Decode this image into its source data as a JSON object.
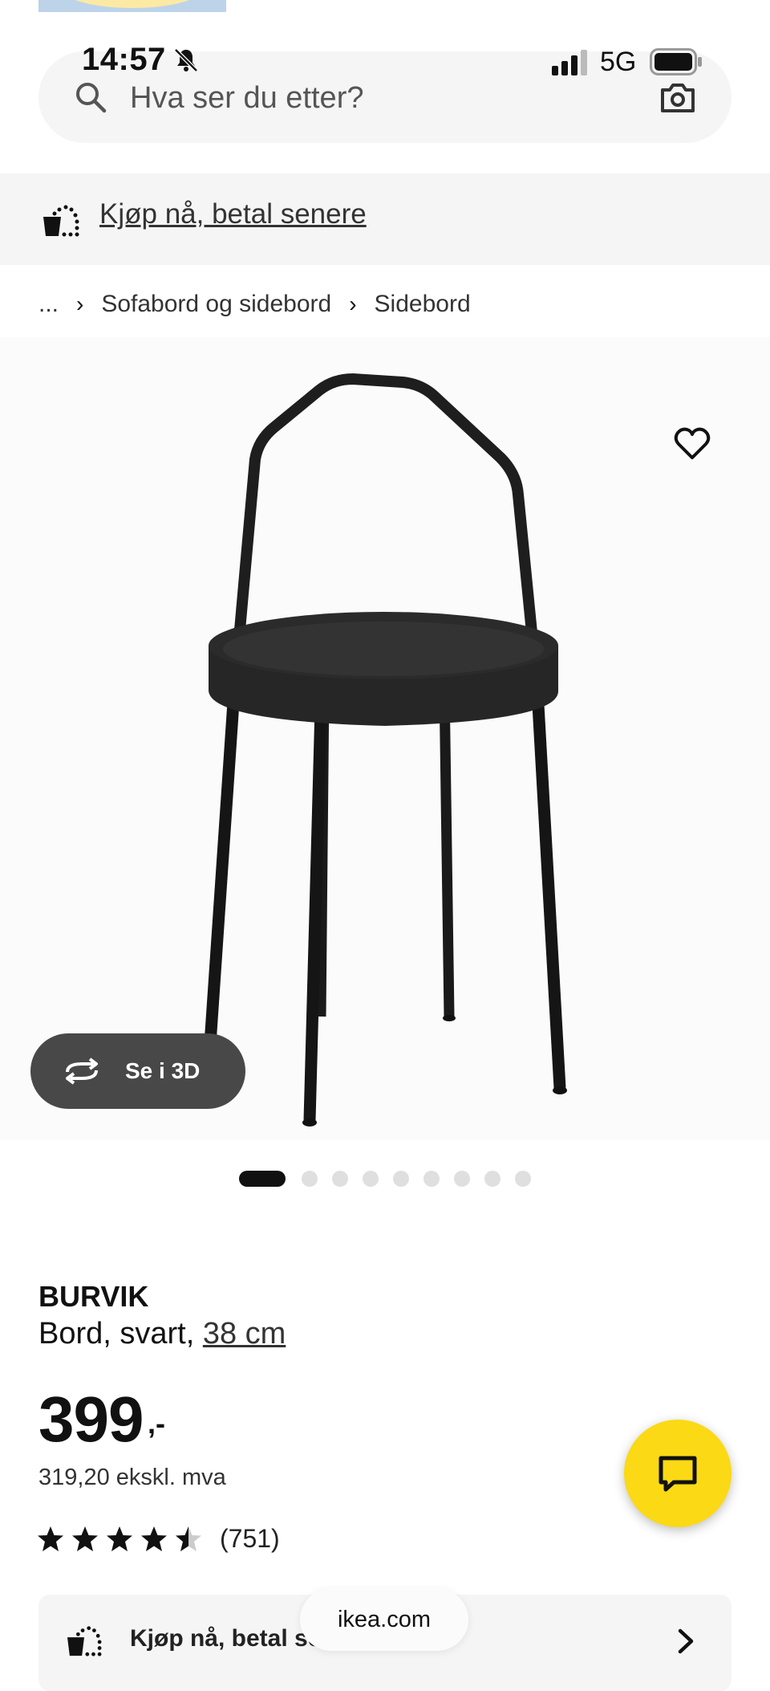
{
  "status_bar": {
    "time": "14:57",
    "network": "5G"
  },
  "search": {
    "placeholder": "Hva ser du etter?"
  },
  "promo_banner": {
    "label": "Kjøp nå, betal senere"
  },
  "breadcrumb": {
    "ellipsis": "...",
    "items": [
      "Sofabord og sidebord",
      "Sidebord"
    ]
  },
  "product": {
    "name": "BURVIK",
    "description": "Bord, svart, ",
    "size": "38 cm",
    "price": "399",
    "price_suffix": ",-",
    "price_ex_vat": "319,20 ekskl. mva",
    "rating": 4.5,
    "review_count": "(751)"
  },
  "viewer": {
    "se3d_label": "Se i 3D",
    "image_count": 9,
    "active_image": 1
  },
  "bottom_card": {
    "label": "Kjøp nå, betal se"
  },
  "browser": {
    "url": "ikea.com"
  },
  "colors": {
    "chat_fab": "#fbd914",
    "se3d_button": "#484848",
    "banner_bg": "#f5f5f5"
  },
  "icons": [
    "bell-slash-icon",
    "signal-icon",
    "battery-icon",
    "search-icon",
    "camera-icon",
    "pay-later-icon",
    "heart-icon",
    "rotate-3d-icon",
    "star-icon",
    "chat-icon",
    "chevron-right-icon"
  ]
}
